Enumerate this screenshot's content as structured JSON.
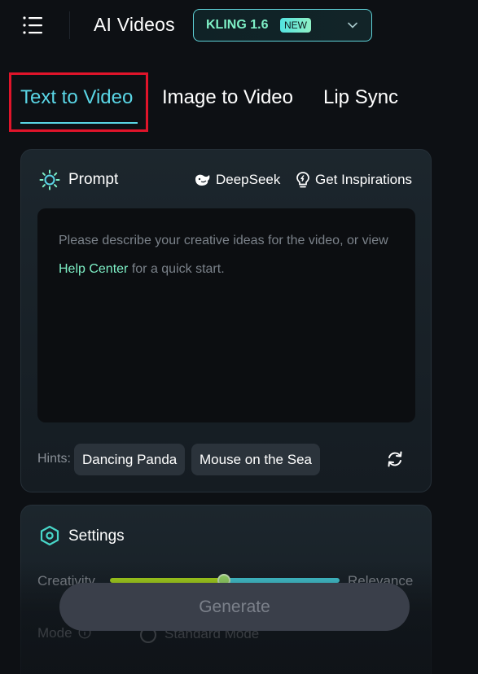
{
  "header": {
    "title": "AI Videos",
    "model": {
      "label": "KLING 1.6",
      "badge": "NEW"
    }
  },
  "tabs": [
    {
      "label": "Text to Video",
      "active": true
    },
    {
      "label": "Image to Video",
      "active": false
    },
    {
      "label": "Lip Sync",
      "active": false
    }
  ],
  "prompt": {
    "title": "Prompt",
    "deepseek_label": "DeepSeek",
    "inspirations_label": "Get Inspirations",
    "placeholder_before": "Please describe your creative ideas for the video, or view ",
    "placeholder_link": "Help Center",
    "placeholder_after": " for a quick start.",
    "hints_label": "Hints:",
    "hints": [
      "Dancing Panda",
      "Mouse on the Sea"
    ]
  },
  "settings": {
    "title": "Settings",
    "slider_left_label": "Creativity",
    "slider_right_label": "Relevance",
    "slider_value": 0.5,
    "mode_label": "Mode",
    "mode_option": "Standard Mode"
  },
  "generate_label": "Generate",
  "colors": {
    "accent": "#5ad6e6",
    "link": "#7ef0c6",
    "highlight_box": "#e0142a",
    "background": "#0d1014"
  },
  "icons": {
    "menu": "menu-icon",
    "chevron": "chevron-down-icon",
    "prompt": "sun-icon",
    "deepseek": "whale-icon",
    "inspirations": "lightbulb-icon",
    "refresh": "refresh-icon",
    "settings": "hexagon-icon",
    "info": "info-icon"
  }
}
